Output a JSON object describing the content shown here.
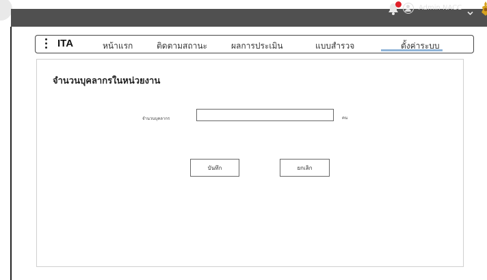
{
  "header": {
    "user_name": "Admin NACC",
    "notification_icon": "bell-icon",
    "avatar_icon": "user-circle-icon",
    "dropdown_icon": "chevron-down-icon",
    "emblem_icon": "emblem-icon",
    "colors": {
      "bar": "#505050",
      "badge": "#e0202a",
      "emblem": "#d6a21f"
    }
  },
  "nav": {
    "menu_icon": "kebab-menu-icon",
    "brand": "ITA",
    "items": [
      {
        "label": "หน้าแรก"
      },
      {
        "label": "ติดตามสถานะ"
      },
      {
        "label": "ผลการประเมิน"
      },
      {
        "label": "แบบสำรวจ"
      },
      {
        "label": "ตั้งค่าระบบ",
        "active": true
      }
    ],
    "active_underline_color": "#8fb4d8"
  },
  "form": {
    "title": "จำนวนบุคลากรในหน่วยงาน",
    "field_label": "จำนวนบุคลากร",
    "field_value": "",
    "unit": "คน",
    "save_label": "บันทึก",
    "cancel_label": "ยกเลิก"
  }
}
